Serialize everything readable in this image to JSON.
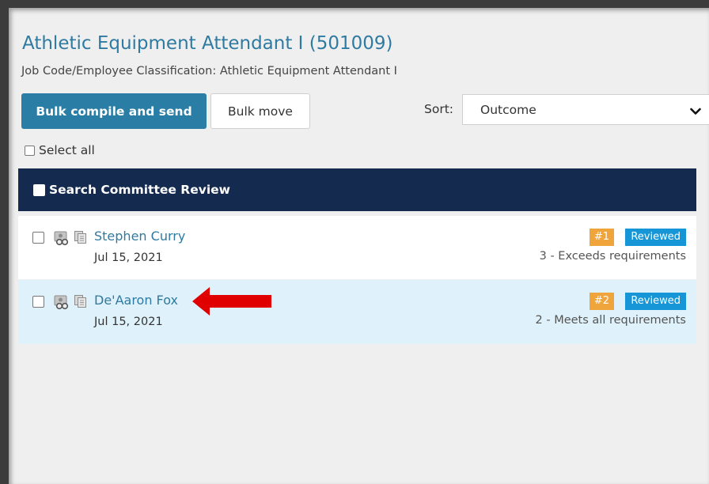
{
  "page": {
    "title": "Athletic Equipment Attendant I (501009)",
    "subtitle": "Job Code/Employee Classification: Athletic Equipment Attendant I"
  },
  "toolbar": {
    "bulk_compile_label": "Bulk compile and send",
    "bulk_move_label": "Bulk move",
    "sort_label": "Sort:",
    "sort_value": "Outcome"
  },
  "select_all_label": "Select all",
  "panel": {
    "header_label": "Search Committee Review",
    "applicants": [
      {
        "name": "Stephen Curry",
        "date": "Jul 15, 2021",
        "rank": "#1",
        "status": "Reviewed",
        "outcome": "3 - Exceeds requirements"
      },
      {
        "name": "De'Aaron Fox",
        "date": "Jul 15, 2021",
        "rank": "#2",
        "status": "Reviewed",
        "outcome": "2 - Meets all requirements",
        "highlighted": true
      }
    ]
  },
  "icons": {
    "row_icon_a": "search-person-icon",
    "row_icon_b": "copy-documents-icon",
    "sort_chevron": "chevron-down-icon",
    "annotation": "red-arrow-icon"
  },
  "colors": {
    "primary_button": "#2a7ea5",
    "header_bg": "#142a4f",
    "link": "#2f7aa1",
    "rank_badge": "#f0a53c",
    "status_badge": "#1696d6",
    "highlight_row": "#dff1fa",
    "annotation_arrow": "#e00000"
  }
}
